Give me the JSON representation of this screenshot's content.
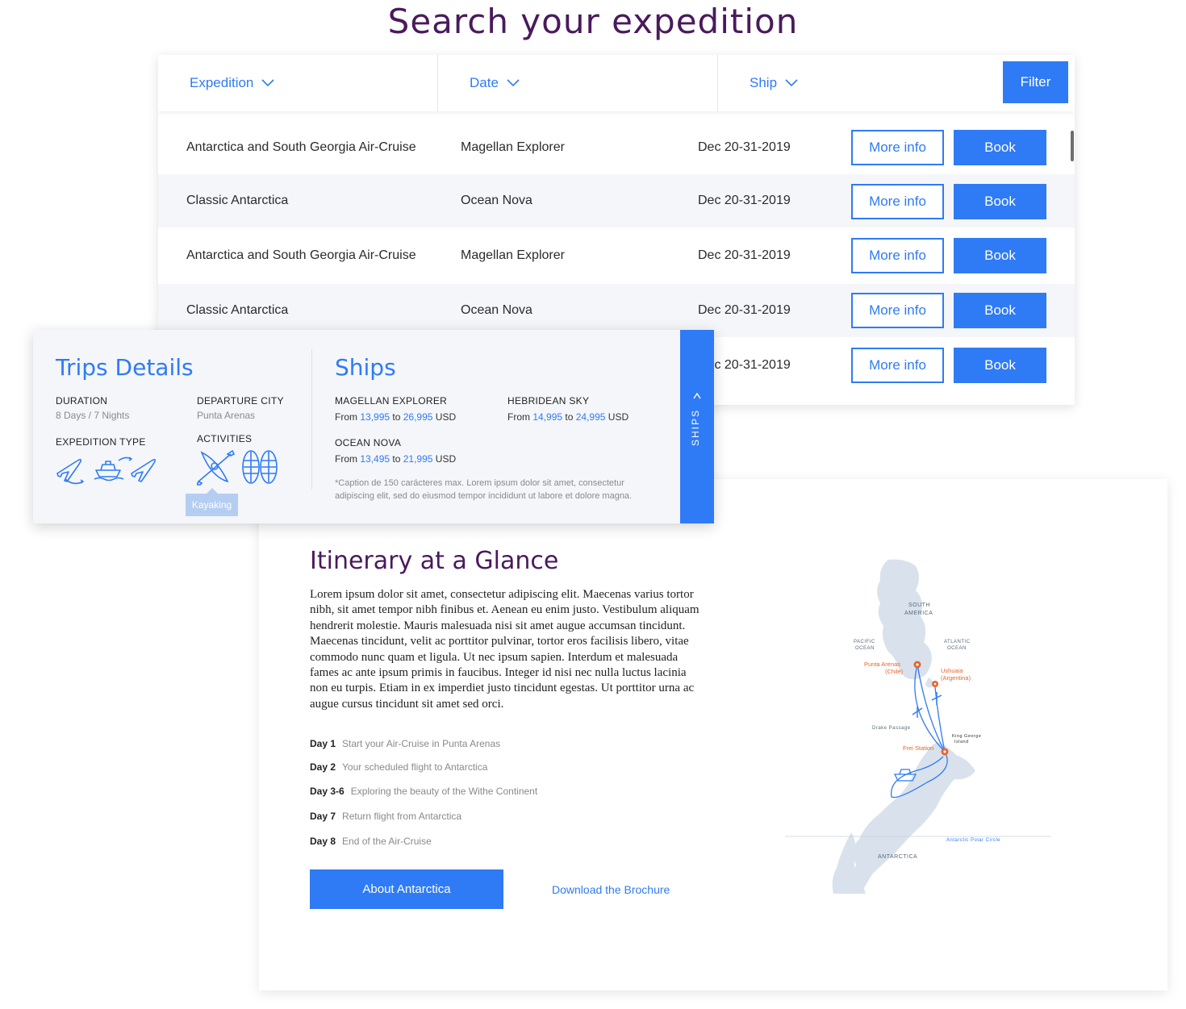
{
  "page": {
    "title": "Search your expedition"
  },
  "filters": {
    "expedition": "Expedition",
    "date": "Date",
    "ship": "Ship",
    "filter_button": "Filter"
  },
  "rows": [
    {
      "expedition": "Antarctica and South Georgia Air-Cruise",
      "ship": "Magellan Explorer",
      "date": "Dec 20-31-2019",
      "more": "More info",
      "book": "Book"
    },
    {
      "expedition": "Classic Antarctica",
      "ship": "Ocean Nova",
      "date": "Dec 20-31-2019",
      "more": "More info",
      "book": "Book"
    },
    {
      "expedition": "Antarctica and South Georgia Air-Cruise",
      "ship": "Magellan Explorer",
      "date": "Dec 20-31-2019",
      "more": "More info",
      "book": "Book"
    },
    {
      "expedition": "Classic Antarctica",
      "ship": "Ocean Nova",
      "date": "Dec 20-31-2019",
      "more": "More info",
      "book": "Book"
    },
    {
      "expedition": "",
      "ship": "",
      "date": "Dec 20-31-2019",
      "more": "More info",
      "book": "Book"
    }
  ],
  "trips": {
    "title": "Trips Details",
    "duration_label": "DURATION",
    "duration_value": "8 Days / 7 Nights",
    "departure_label": "DEPARTURE CITY",
    "departure_value": "Punta Arenas",
    "expedition_type_label": "EXPEDITION TYPE",
    "activities_label": "ACTIVITIES",
    "tooltip": "Kayaking",
    "ships_title": "Ships",
    "ships": [
      {
        "name": "MAGELLAN EXPLORER",
        "from": "From",
        "low": "13,995",
        "to": "to",
        "high": "26,995",
        "currency": "USD"
      },
      {
        "name": "HEBRIDEAN SKY",
        "from": "From",
        "low": "14,995",
        "to": "to",
        "high": "24,995",
        "currency": "USD"
      },
      {
        "name": "OCEAN NOVA",
        "from": "From",
        "low": "13,495",
        "to": "to",
        "high": "21,995",
        "currency": "USD"
      }
    ],
    "caption": "*Caption de 150 carácteres max. Lorem ipsum dolor sit amet, consectetur adipiscing elit, sed do eiusmod tempor incididunt ut labore et dolore magna.",
    "ships_tab": "SHIPS"
  },
  "itinerary": {
    "title": "Itinerary at a Glance",
    "body": "Lorem ipsum dolor sit amet, consectetur adipiscing elit. Maecenas varius tortor nibh, sit amet tempor nibh finibus et. Aenean eu enim justo. Vestibulum aliquam hendrerit molestie. Mauris malesuada nisi sit amet augue accumsan tincidunt. Maecenas tincidunt, velit ac porttitor pulvinar, tortor eros facilisis libero, vitae commodo nunc quam et ligula. Ut nec ipsum sapien. Interdum et malesuada fames ac ante ipsum primis in faucibus. Integer id nisi nec nulla luctus lacinia non eu turpis. Etiam in ex imperdiet justo tincidunt egestas. Ut porttitor urna ac augue cursus tincidunt sit amet sed orci.",
    "days": [
      {
        "label": "Day 1",
        "text": "Start your Air-Cruise in Punta Arenas"
      },
      {
        "label": "Day 2",
        "text": "Your scheduled flight to Antarctica"
      },
      {
        "label": "Day 3-6",
        "text": "Exploring the beauty of the Withe Continent"
      },
      {
        "label": "Day 7",
        "text": "Return flight from Antarctica"
      },
      {
        "label": "Day 8",
        "text": "End of the Air-Cruise"
      }
    ],
    "about_button": "About Antarctica",
    "brochure_link": "Download the Brochure"
  },
  "map": {
    "south_america_1": "SOUTH",
    "south_america_2": "AMERICA",
    "pacific_1": "PACIFIC",
    "pacific_2": "OCEAN",
    "atlantic_1": "ATLANTIC",
    "atlantic_2": "OCEAN",
    "punta_1": "Punta Arenas",
    "punta_2": "(Chile)",
    "ushuaia_1": "Ushuaia",
    "ushuaia_2": "(Argentina)",
    "drake": "Drake Passage",
    "king_1": "King George",
    "king_2": "Island",
    "frei": "Frei Station",
    "antarctica": "ANTARCTICA",
    "polar": "Antarctic Polar Circle"
  },
  "colors": {
    "accent": "#2f7bf5",
    "title": "#4a1a5c",
    "map_land": "#d9e2ec",
    "map_route": "#e8642c"
  }
}
